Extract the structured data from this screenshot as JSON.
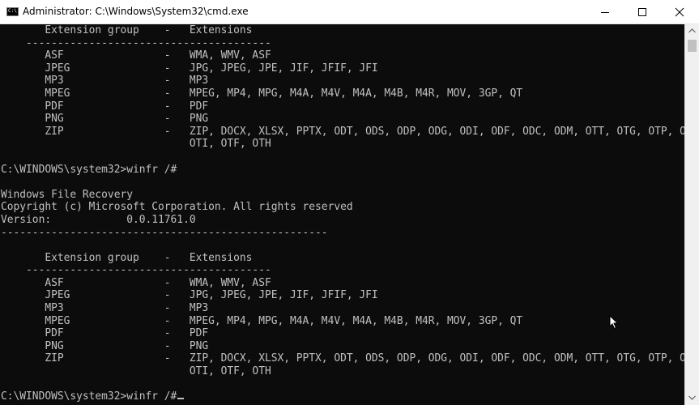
{
  "window": {
    "title": "Administrator: C:\\Windows\\System32\\cmd.exe",
    "icon_text": "C:\\"
  },
  "icons": {
    "app": "cmd-icon",
    "minimize": "minimize-icon",
    "maximize": "maximize-icon",
    "close": "close-icon",
    "scroll_up": "chevron-up-icon",
    "scroll_down": "chevron-down-icon",
    "pointer": "mouse-pointer-icon"
  },
  "colors": {
    "console_background": "#0c0c0c",
    "console_text": "#c0c0c0",
    "titlebar_background": "#ffffff"
  },
  "console": {
    "lines": [
      "       Extension group    -   Extensions",
      "    ---------------------------------------",
      "       ASF                -   WMA, WMV, ASF",
      "       JPEG               -   JPG, JPEG, JPE, JIF, JFIF, JFI",
      "       MP3                -   MP3",
      "       MPEG               -   MPEG, MP4, MPG, M4A, M4V, M4A, M4B, M4R, MOV, 3GP, QT",
      "       PDF                -   PDF",
      "       PNG                -   PNG",
      "       ZIP                -   ZIP, DOCX, XLSX, PPTX, ODT, ODS, ODP, ODG, ODI, ODF, ODC, ODM, OTT, OTG, OTP, OTS, OTC,",
      "                              OTI, OTF, OTH",
      "",
      "C:\\WINDOWS\\system32>winfr /#",
      "",
      "Windows File Recovery",
      "Copyright (c) Microsoft Corporation. All rights reserved",
      "Version:            0.0.11761.0",
      "----------------------------------------------------",
      "",
      "       Extension group    -   Extensions",
      "    ---------------------------------------",
      "       ASF                -   WMA, WMV, ASF",
      "       JPEG               -   JPG, JPEG, JPE, JIF, JFIF, JFI",
      "       MP3                -   MP3",
      "       MPEG               -   MPEG, MP4, MPG, M4A, M4V, M4A, M4B, M4R, MOV, 3GP, QT",
      "       PDF                -   PDF",
      "       PNG                -   PNG",
      "       ZIP                -   ZIP, DOCX, XLSX, PPTX, ODT, ODS, ODP, ODG, ODI, ODF, ODC, ODM, OTT, OTG, OTP, OTS, OTC,",
      "                              OTI, OTF, OTH",
      "",
      "C:\\WINDOWS\\system32>winfr /#"
    ]
  }
}
